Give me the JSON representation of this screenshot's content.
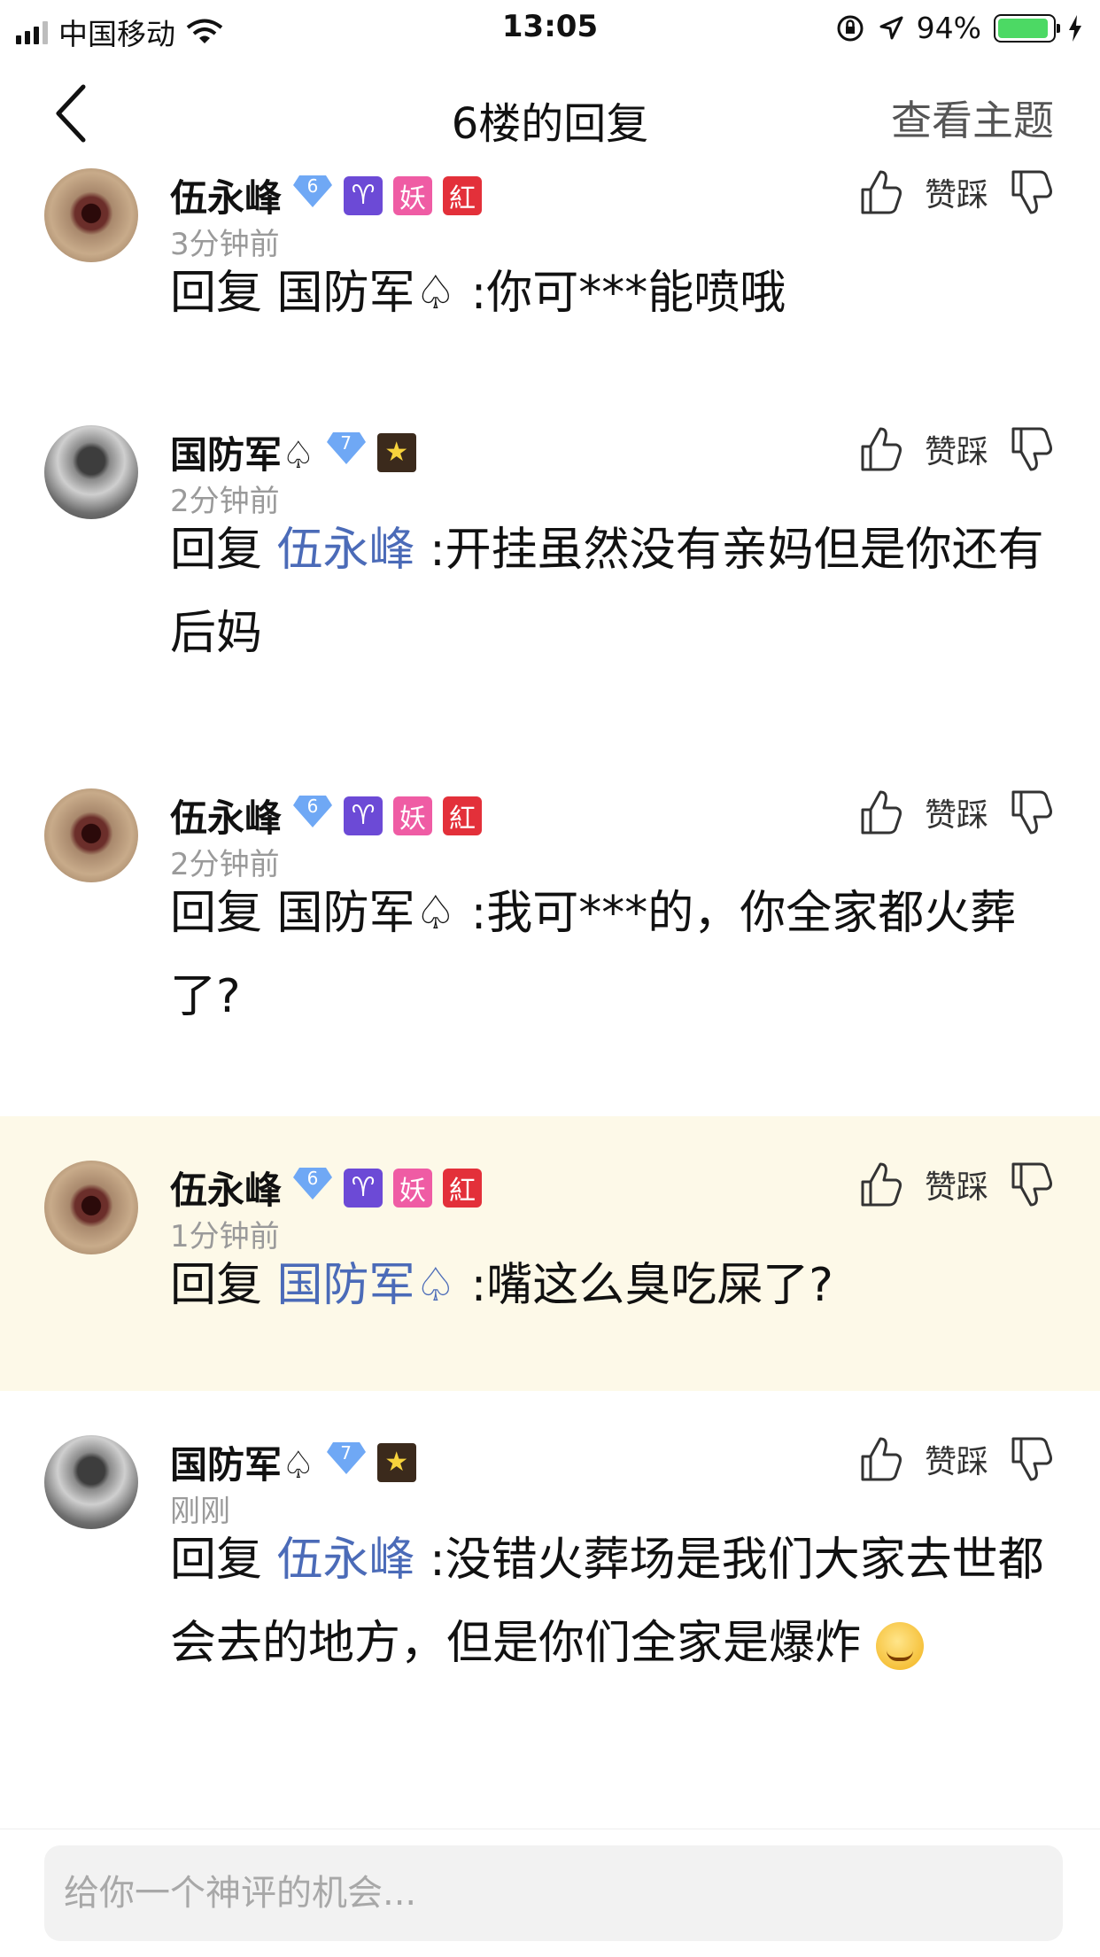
{
  "status_bar": {
    "carrier": "中国移动",
    "time": "13:05",
    "battery": "94%",
    "battery_level": 0.94
  },
  "nav": {
    "title": "6楼的回复",
    "topic_link": "查看主题"
  },
  "actions": {
    "like_dislike_label": "赞踩"
  },
  "comments": [
    {
      "user": "伍永峰",
      "time": "3分钟前",
      "level": "6",
      "badges": [
        "♈",
        "妖",
        "紅"
      ],
      "prefix": "回复",
      "mention": "国防军♤",
      "body": ":你可***能喷哦",
      "highlighted": false
    },
    {
      "user": "国防军♤",
      "time": "2分钟前",
      "level": "7",
      "badges": [
        "★"
      ],
      "prefix": "回复",
      "mention": "伍永峰",
      "body": ":开挂虽然没有亲妈但是你还有后妈",
      "highlighted": false
    },
    {
      "user": "伍永峰",
      "time": "2分钟前",
      "level": "6",
      "badges": [
        "♈",
        "妖",
        "紅"
      ],
      "prefix": "回复",
      "mention": "国防军♤",
      "body": ":我可***的，你全家都火葬了?",
      "highlighted": false
    },
    {
      "user": "伍永峰",
      "time": "1分钟前",
      "level": "6",
      "badges": [
        "♈",
        "妖",
        "紅"
      ],
      "prefix": "回复",
      "mention": "国防军♤",
      "body": ":嘴这么臭吃屎了?",
      "highlighted": true
    },
    {
      "user": "国防军♤",
      "time": "刚刚",
      "level": "7",
      "badges": [
        "★"
      ],
      "prefix": "回复",
      "mention": "伍永峰",
      "body": ":没错火葬场是我们大家去世都会去的地方，但是你们全家是爆炸",
      "highlighted": false
    }
  ],
  "input": {
    "placeholder": "给你一个神评的机会..."
  },
  "colors": {
    "mention": "#4b6bb8",
    "highlight_bg": "#fdf9e8",
    "battery": "#4cd964"
  },
  "icons": [
    "signal-icon",
    "wifi-icon",
    "orientation-lock-icon",
    "location-arrow-icon",
    "battery-icon",
    "charging-bolt-icon",
    "back-chevron-icon",
    "thumb-up-icon",
    "thumb-down-icon",
    "diamond-level-icon",
    "smile-emoji-icon"
  ]
}
